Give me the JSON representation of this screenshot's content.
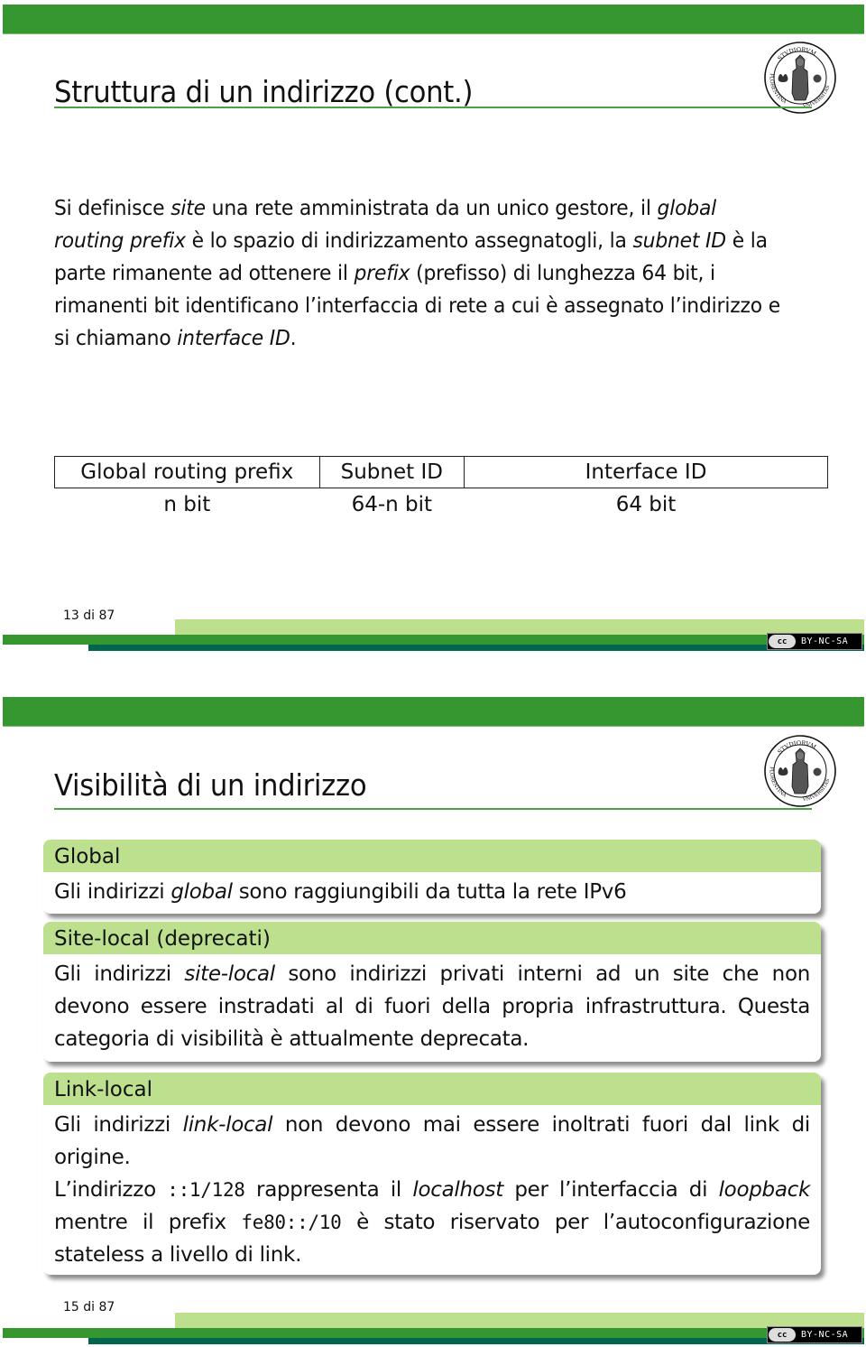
{
  "slides": [
    {
      "title": "Struttura di un indirizzo (cont.)",
      "paragraph": {
        "segments": [
          {
            "text": "Si definisce ",
            "italic": false
          },
          {
            "text": "site",
            "italic": true
          },
          {
            "text": " una rete amministrata da un unico gestore, il ",
            "italic": false
          },
          {
            "text": "global routing prefix",
            "italic": true
          },
          {
            "text": " è lo spazio di indirizzamento assegnatogli, la ",
            "italic": false
          },
          {
            "text": "subnet ID",
            "italic": true
          },
          {
            "text": " è la parte rimanente ad ottenere il ",
            "italic": false
          },
          {
            "text": "prefix",
            "italic": true
          },
          {
            "text": " (prefisso) di lunghezza 64 bit, i rimanenti bit identificano l’interfaccia di rete a cui è assegnato l’indirizzo e si chiamano ",
            "italic": false
          },
          {
            "text": "interface ID",
            "italic": true
          },
          {
            "text": ".",
            "italic": false
          }
        ]
      },
      "table": {
        "headers": [
          "Global routing prefix",
          "Subnet ID",
          "Interface ID"
        ],
        "bits": [
          "n bit",
          "64-n bit",
          "64 bit"
        ]
      },
      "page_number": "13 di 87",
      "license": {
        "logo": "cc",
        "text": "BY-NC-SA"
      }
    },
    {
      "title": "Visibilità di un indirizzo",
      "blocks": [
        {
          "title": "Global",
          "body": [
            {
              "text": "Gli indirizzi ",
              "style": "normal"
            },
            {
              "text": "global",
              "style": "italic"
            },
            {
              "text": " sono raggiungibili da tutta la rete IPv6",
              "style": "normal"
            }
          ]
        },
        {
          "title": "Site-local (deprecati)",
          "body": [
            {
              "text": "Gli indirizzi ",
              "style": "normal"
            },
            {
              "text": "site-local",
              "style": "italic"
            },
            {
              "text": " sono indirizzi privati interni ad un site che non devono essere instradati al di fuori della propria infrastruttura. Questa categoria di visibilità è attualmente deprecata.",
              "style": "normal"
            }
          ]
        },
        {
          "title": "Link-local",
          "body": [
            {
              "text": "Gli indirizzi ",
              "style": "normal"
            },
            {
              "text": "link-local",
              "style": "italic"
            },
            {
              "text": " non devono mai essere inoltrati fuori dal link di origine.",
              "style": "normal"
            },
            {
              "text": "\n",
              "style": "break"
            },
            {
              "text": "L’indirizzo ",
              "style": "normal"
            },
            {
              "text": "::1/128",
              "style": "code"
            },
            {
              "text": " rappresenta il ",
              "style": "normal"
            },
            {
              "text": "localhost",
              "style": "italic"
            },
            {
              "text": " per l’interfaccia di ",
              "style": "normal"
            },
            {
              "text": "loopback",
              "style": "italic"
            },
            {
              "text": " mentre il prefix ",
              "style": "normal"
            },
            {
              "text": "fe80::/10",
              "style": "code"
            },
            {
              "text": " è stato riservato per l’autoconfigurazione stateless a livello di link.",
              "style": "normal"
            }
          ]
        }
      ],
      "page_number": "15 di 87",
      "license": {
        "logo": "cc",
        "text": "BY-NC-SA"
      }
    }
  ],
  "seal": {
    "icon": "university-seal-icon",
    "upper_text": "STVDIORVM",
    "left_text": "FLORENTINA",
    "right_text": "VNIVERSITAS"
  },
  "colors": {
    "header_green": "#36962f",
    "block_title_bg": "#bde08f",
    "footer_light": "#bde08f",
    "footer_teal": "#00664f"
  }
}
